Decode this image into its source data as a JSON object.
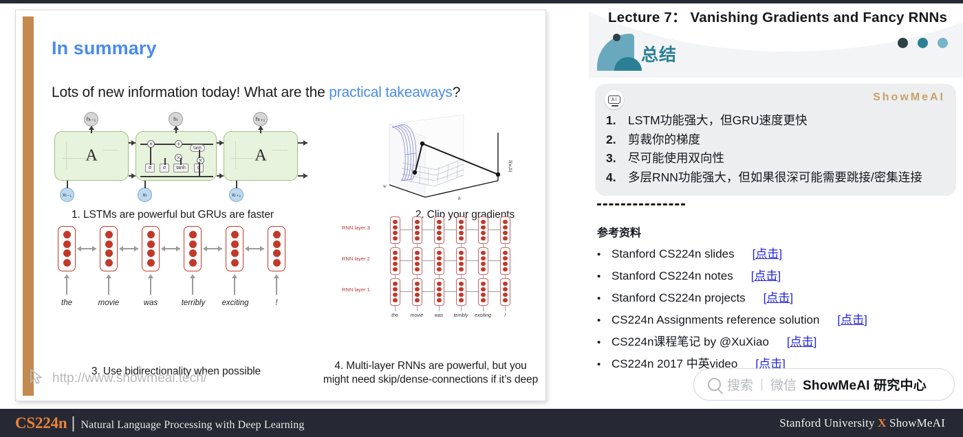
{
  "footer": {
    "course_code": "CS224n",
    "divider": "|",
    "course_name": "Natural Language Processing with Deep Learning",
    "affiliation_left": "Stanford University ",
    "affiliation_x": "X",
    "affiliation_right": " ShowMeAI"
  },
  "slide": {
    "title": "In summary",
    "lead_prefix": "Lots of new information today! What are the ",
    "lead_highlight": "practical takeaways",
    "lead_suffix": "?",
    "captions": {
      "one": "1. LSTMs are powerful but GRUs are faster",
      "two": "2. Clip your gradients",
      "three": "3. Use bidirectionality when possible",
      "four_line1": "4. Multi-layer RNNs are powerful, but you",
      "four_line2": "might need skip/dense-connections if it’s deep"
    },
    "lstm": {
      "cell_label": "A",
      "h_labels": [
        "hₜ₋₁",
        "hₜ",
        "hₜ₊₁"
      ],
      "x_labels": [
        "xₜ₋₁",
        "xₜ",
        "xₜ₊₁"
      ],
      "gates": [
        "σ",
        "σ",
        "tanh",
        "σ"
      ],
      "ops": [
        "×",
        "+",
        "×",
        "×"
      ],
      "tanh_pill": "tanh"
    },
    "surface": {
      "axis_w": "w",
      "axis_b": "b",
      "axis_j": "J(w,b)"
    },
    "birnn": {
      "words": [
        "the",
        "movie",
        "was",
        "terribly",
        "exciting",
        "!"
      ]
    },
    "multilayer": {
      "layers": [
        "RNN layer 3",
        "RNN layer 2",
        "RNN layer 1"
      ],
      "words": [
        "the",
        "movie",
        "was",
        "terribly",
        "exciting",
        "!"
      ]
    },
    "watermark": "http://www.showmeai.tech/"
  },
  "right_panel": {
    "lecture_title": "Lecture 7： Vanishing Gradients and Fancy RNNs",
    "section_title": "总结",
    "dot_colors": [
      "#2d4246",
      "#2a7f95",
      "#76b5c9"
    ],
    "card": {
      "ai_badge": "AI",
      "brand_mark": "ShowMeAI",
      "items": [
        {
          "num": "1.",
          "text": "LSTM功能强大，但GRU速度更快"
        },
        {
          "num": "2.",
          "text": "剪裁你的梯度"
        },
        {
          "num": "3.",
          "text": "尽可能使用双向性"
        },
        {
          "num": "4.",
          "text": "多层RNN功能强大，但如果很深可能需要跳接/密集连接"
        }
      ]
    },
    "references_heading": "参考资料",
    "references": [
      {
        "label": "Stanford CS224n slides",
        "link": "点击"
      },
      {
        "label": "Stanford CS224n notes",
        "link": "点击"
      },
      {
        "label": "Stanford CS224n projects",
        "link": "点击"
      },
      {
        "label": "CS224n Assignments reference solution",
        "link": "点击"
      },
      {
        "label": "CS224n课程笔记 by @XuXiao",
        "link": "点击"
      },
      {
        "label": "CS224n 2017 中英video",
        "link": "点击"
      }
    ],
    "search": {
      "placeholder": "搜索",
      "divider": "|",
      "channel": "微信",
      "brand": "ShowMeAI 研究中心"
    }
  }
}
